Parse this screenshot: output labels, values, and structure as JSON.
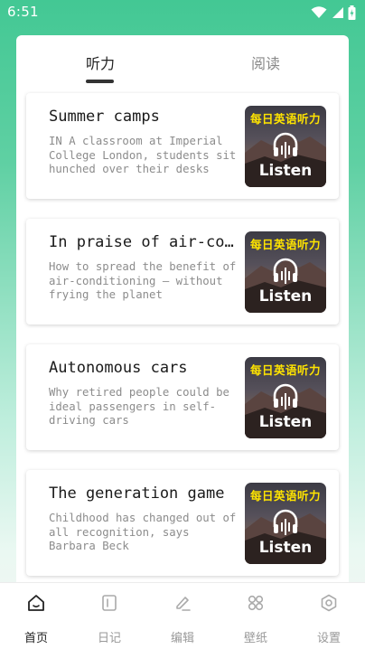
{
  "status_bar": {
    "time": "6:51"
  },
  "tabs": [
    {
      "label": "听力",
      "active": true
    },
    {
      "label": "阅读",
      "active": false
    }
  ],
  "articles": [
    {
      "title": "Summer camps",
      "description": "IN A classroom at Imperial College London, students sit hunched over their desks",
      "thumb_title": "每日英语听力",
      "thumb_label": "Listen"
    },
    {
      "title": "In praise of air-conditioning",
      "description": "How to spread the benefit of air-conditioning — without frying the planet",
      "thumb_title": "每日英语听力",
      "thumb_label": "Listen"
    },
    {
      "title": "Autonomous cars",
      "description": "Why retired people could be ideal passengers in self-driving cars",
      "thumb_title": "每日英语听力",
      "thumb_label": "Listen"
    },
    {
      "title": "The generation game",
      "description": "Childhood has changed out of all recognition, says Barbara Beck",
      "thumb_title": "每日英语听力",
      "thumb_label": "Listen"
    }
  ],
  "bottom_nav": [
    {
      "label": "首页",
      "icon": "home-icon",
      "active": true
    },
    {
      "label": "日记",
      "icon": "diary-icon",
      "active": false
    },
    {
      "label": "编辑",
      "icon": "edit-icon",
      "active": false
    },
    {
      "label": "壁纸",
      "icon": "wallpaper-icon",
      "active": false
    },
    {
      "label": "设置",
      "icon": "settings-icon",
      "active": false
    }
  ],
  "colors": {
    "header_green": "#43c894",
    "thumb_title_yellow": "#ffe400",
    "active_text": "#222222",
    "inactive_text": "#999999"
  }
}
